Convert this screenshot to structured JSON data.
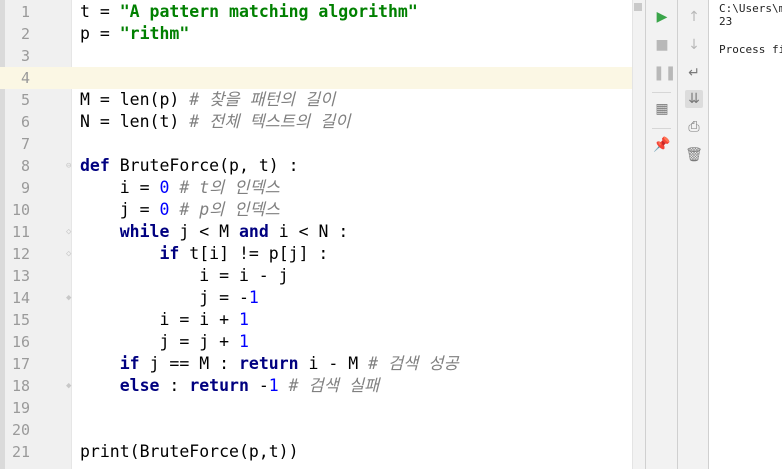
{
  "editor": {
    "lines": [
      {
        "n": "1",
        "code": "t = \"A pattern matching algorithm\""
      },
      {
        "n": "2",
        "code": "p = \"rithm\""
      },
      {
        "n": "3",
        "code": ""
      },
      {
        "n": "4",
        "code": ""
      },
      {
        "n": "5",
        "code": "M = len(p) # 찾을 패턴의 길이"
      },
      {
        "n": "6",
        "code": "N = len(t) # 전체 텍스트의 길이"
      },
      {
        "n": "7",
        "code": ""
      },
      {
        "n": "8",
        "code": "def BruteForce(p, t) :"
      },
      {
        "n": "9",
        "code": "    i = 0 # t의 인덱스"
      },
      {
        "n": "10",
        "code": "    j = 0 # p의 인덱스"
      },
      {
        "n": "11",
        "code": "    while j < M and i < N :"
      },
      {
        "n": "12",
        "code": "        if t[i] != p[j] :"
      },
      {
        "n": "13",
        "code": "            i = i - j"
      },
      {
        "n": "14",
        "code": "            j = -1"
      },
      {
        "n": "15",
        "code": "        i = i + 1"
      },
      {
        "n": "16",
        "code": "        j = j + 1"
      },
      {
        "n": "17",
        "code": "    if j == M : return i - M # 검색 성공"
      },
      {
        "n": "18",
        "code": "    else : return -1 # 검색 실패"
      },
      {
        "n": "19",
        "code": ""
      },
      {
        "n": "20",
        "code": ""
      },
      {
        "n": "21",
        "code": "print(BruteForce(p,t))"
      }
    ]
  },
  "toolbar": {
    "run_icon": "play-icon",
    "stop_icon": "stop-icon",
    "pause_icon": "pause-icon",
    "layout_icon": "layout-icon",
    "pin_icon": "pin-icon",
    "up_icon": "arrow-up-icon",
    "down_icon": "arrow-down-icon",
    "wrap_icon": "soft-wrap-icon",
    "scroll_end_icon": "scroll-to-end-icon",
    "print_icon": "print-icon",
    "trash_icon": "trash-icon"
  },
  "console": {
    "path_line": "C:\\Users\\m",
    "output_value": "23",
    "process_line": "Process fi"
  },
  "colors": {
    "keyword": "#000080",
    "string": "#008000",
    "number": "#0000ff",
    "comment": "#808080",
    "current_line": "#fbf7e4",
    "run_green": "#3aa54a"
  }
}
